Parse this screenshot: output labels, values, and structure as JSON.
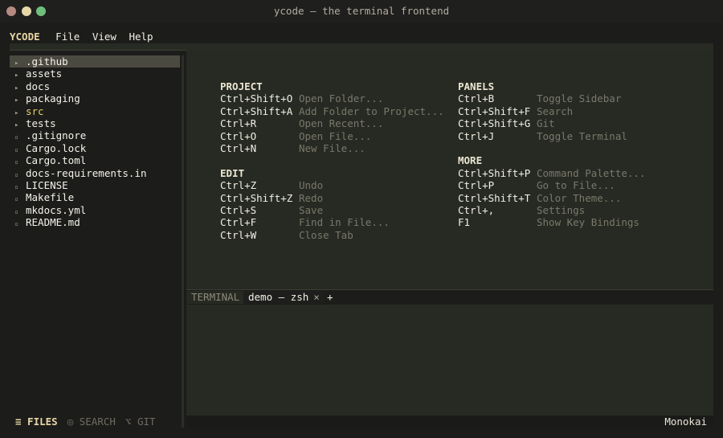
{
  "window": {
    "title": "ycode — the terminal frontend",
    "traffic_lights": {
      "close": "#b58a80",
      "minimize": "#e6d8a9",
      "zoom": "#6fbf7c"
    }
  },
  "menubar": {
    "brand": "YCODE",
    "items": [
      "File",
      "View",
      "Help"
    ]
  },
  "sidebar": {
    "items": [
      {
        "label": ".github",
        "type": "folder",
        "selected": true
      },
      {
        "label": "assets",
        "type": "folder"
      },
      {
        "label": "docs",
        "type": "folder"
      },
      {
        "label": "packaging",
        "type": "folder"
      },
      {
        "label": "src",
        "type": "folder",
        "highlight": true
      },
      {
        "label": "tests",
        "type": "folder"
      },
      {
        "label": ".gitignore",
        "type": "file"
      },
      {
        "label": "Cargo.lock",
        "type": "file"
      },
      {
        "label": "Cargo.toml",
        "type": "file"
      },
      {
        "label": "docs-requirements.in",
        "type": "file"
      },
      {
        "label": "LICENSE",
        "type": "file"
      },
      {
        "label": "Makefile",
        "type": "file"
      },
      {
        "label": "mkdocs.yml",
        "type": "file"
      },
      {
        "label": "README.md",
        "type": "file"
      }
    ],
    "tabs": [
      {
        "icon": "≡",
        "label": "FILES",
        "active": true
      },
      {
        "icon": "◎",
        "label": "SEARCH"
      },
      {
        "icon": "⌥",
        "label": "GIT"
      }
    ]
  },
  "shortcuts": {
    "left": [
      {
        "title": "PROJECT",
        "rows": [
          {
            "key": "Ctrl+Shift+O",
            "action": "Open Folder..."
          },
          {
            "key": "Ctrl+Shift+A",
            "action": "Add Folder to Project..."
          },
          {
            "key": "Ctrl+R",
            "action": "Open Recent..."
          },
          {
            "key": "Ctrl+O",
            "action": "Open File..."
          },
          {
            "key": "Ctrl+N",
            "action": "New File..."
          }
        ]
      },
      {
        "title": "EDIT",
        "rows": [
          {
            "key": "Ctrl+Z",
            "action": "Undo"
          },
          {
            "key": "Ctrl+Shift+Z",
            "action": "Redo"
          },
          {
            "key": "Ctrl+S",
            "action": "Save"
          },
          {
            "key": "Ctrl+F",
            "action": "Find in File..."
          },
          {
            "key": "Ctrl+W",
            "action": "Close Tab"
          }
        ]
      }
    ],
    "right": [
      {
        "title": "PANELS",
        "rows": [
          {
            "key": "Ctrl+B",
            "action": "Toggle Sidebar"
          },
          {
            "key": "Ctrl+Shift+F",
            "action": "Search"
          },
          {
            "key": "Ctrl+Shift+G",
            "action": "Git"
          },
          {
            "key": "Ctrl+J",
            "action": "Toggle Terminal"
          }
        ]
      },
      {
        "title": "MORE",
        "rows": [
          {
            "key": "Ctrl+Shift+P",
            "action": "Command Palette..."
          },
          {
            "key": "Ctrl+P",
            "action": "Go to File..."
          },
          {
            "key": "Ctrl+Shift+T",
            "action": "Color Theme..."
          },
          {
            "key": "Ctrl+,",
            "action": "Settings"
          },
          {
            "key": "F1",
            "action": "Show Key Bindings"
          }
        ]
      }
    ]
  },
  "terminal": {
    "panel_label": "TERMINAL",
    "tabs": [
      {
        "label": "demo — zsh",
        "close": "×"
      }
    ],
    "add": "+"
  },
  "status": {
    "theme": "Monokai"
  }
}
